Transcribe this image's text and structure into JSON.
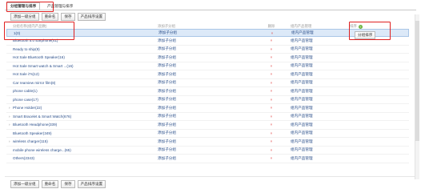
{
  "tabs": [
    {
      "label": "分组管理与排序"
    },
    {
      "label": "产品管理与排序"
    }
  ],
  "toolbar": {
    "add_first_level": "添加一级分组",
    "rename": "重命名",
    "save": "保存",
    "product_sort_settings": "产品排序设置"
  },
  "table": {
    "headers": {
      "name": "分组名称(组内产品数)",
      "add": "添加子分组",
      "delete": "删除",
      "manage": "组内产品管理",
      "sort": "排序"
    },
    "rows": [
      {
        "name": "1(0)",
        "add": "添加子分组",
        "del": "×",
        "manage": "组内产品管理",
        "expand": ""
      },
      {
        "name": "Bluetooth 5.0 Earphone(41)",
        "add": "添加子分组",
        "del": "×",
        "manage": "组内产品管理",
        "expand": ""
      },
      {
        "name": "Ready to ship(9)",
        "add": "添加子分组",
        "del": "×",
        "manage": "组内产品管理",
        "expand": ""
      },
      {
        "name": "Hot Sale Bluetooth Speaker(16)",
        "add": "添加子分组",
        "del": "×",
        "manage": "组内产品管理",
        "expand": ""
      },
      {
        "name": "Hot Sale Smart watch & Smart ...(16)",
        "add": "添加子分组",
        "del": "×",
        "manage": "组内产品管理",
        "expand": ""
      },
      {
        "name": "Hot Sale i7s(12)",
        "add": "添加子分组",
        "del": "×",
        "manage": "组内产品管理",
        "expand": ""
      },
      {
        "name": "Car rearview mirror film(8)",
        "add": "添加子分组",
        "del": "×",
        "manage": "组内产品管理",
        "expand": ""
      },
      {
        "name": "phone cable(1)",
        "add": "添加子分组",
        "del": "×",
        "manage": "组内产品管理",
        "expand": ""
      },
      {
        "name": "phone case(17)",
        "add": "添加子分组",
        "del": "×",
        "manage": "组内产品管理",
        "expand": ""
      },
      {
        "name": "Phone Holder(22)",
        "add": "添加子分组",
        "del": "×",
        "manage": "组内产品管理",
        "expand": "›"
      },
      {
        "name": "Smart Bracelet & Smart Watch(676)",
        "add": "添加子分组",
        "del": "×",
        "manage": "组内产品管理",
        "expand": "›"
      },
      {
        "name": "Bluetooth Headphone(339)",
        "add": "添加子分组",
        "del": "×",
        "manage": "组内产品管理",
        "expand": "›"
      },
      {
        "name": "Bluetooth Speaker(349)",
        "add": "添加子分组",
        "del": "×",
        "manage": "组内产品管理",
        "expand": ""
      },
      {
        "name": "wireless charger(115)",
        "add": "添加子分组",
        "del": "×",
        "manage": "组内产品管理",
        "expand": "›"
      },
      {
        "name": "mobile phone wireless charge...(65)",
        "add": "添加子分组",
        "del": "×",
        "manage": "组内产品管理",
        "expand": ""
      },
      {
        "name": "Others(2343)",
        "add": "添加子分组",
        "del": "×",
        "manage": "组内产品管理",
        "expand": ""
      }
    ]
  },
  "sort_panel": {
    "label": "排序",
    "help_icon": "?",
    "button": "分组排序"
  },
  "colors": {
    "annotation": "#e02020",
    "link": "#2b4f8a",
    "delete": "#e04040",
    "selected_row": "#dce9f8"
  }
}
